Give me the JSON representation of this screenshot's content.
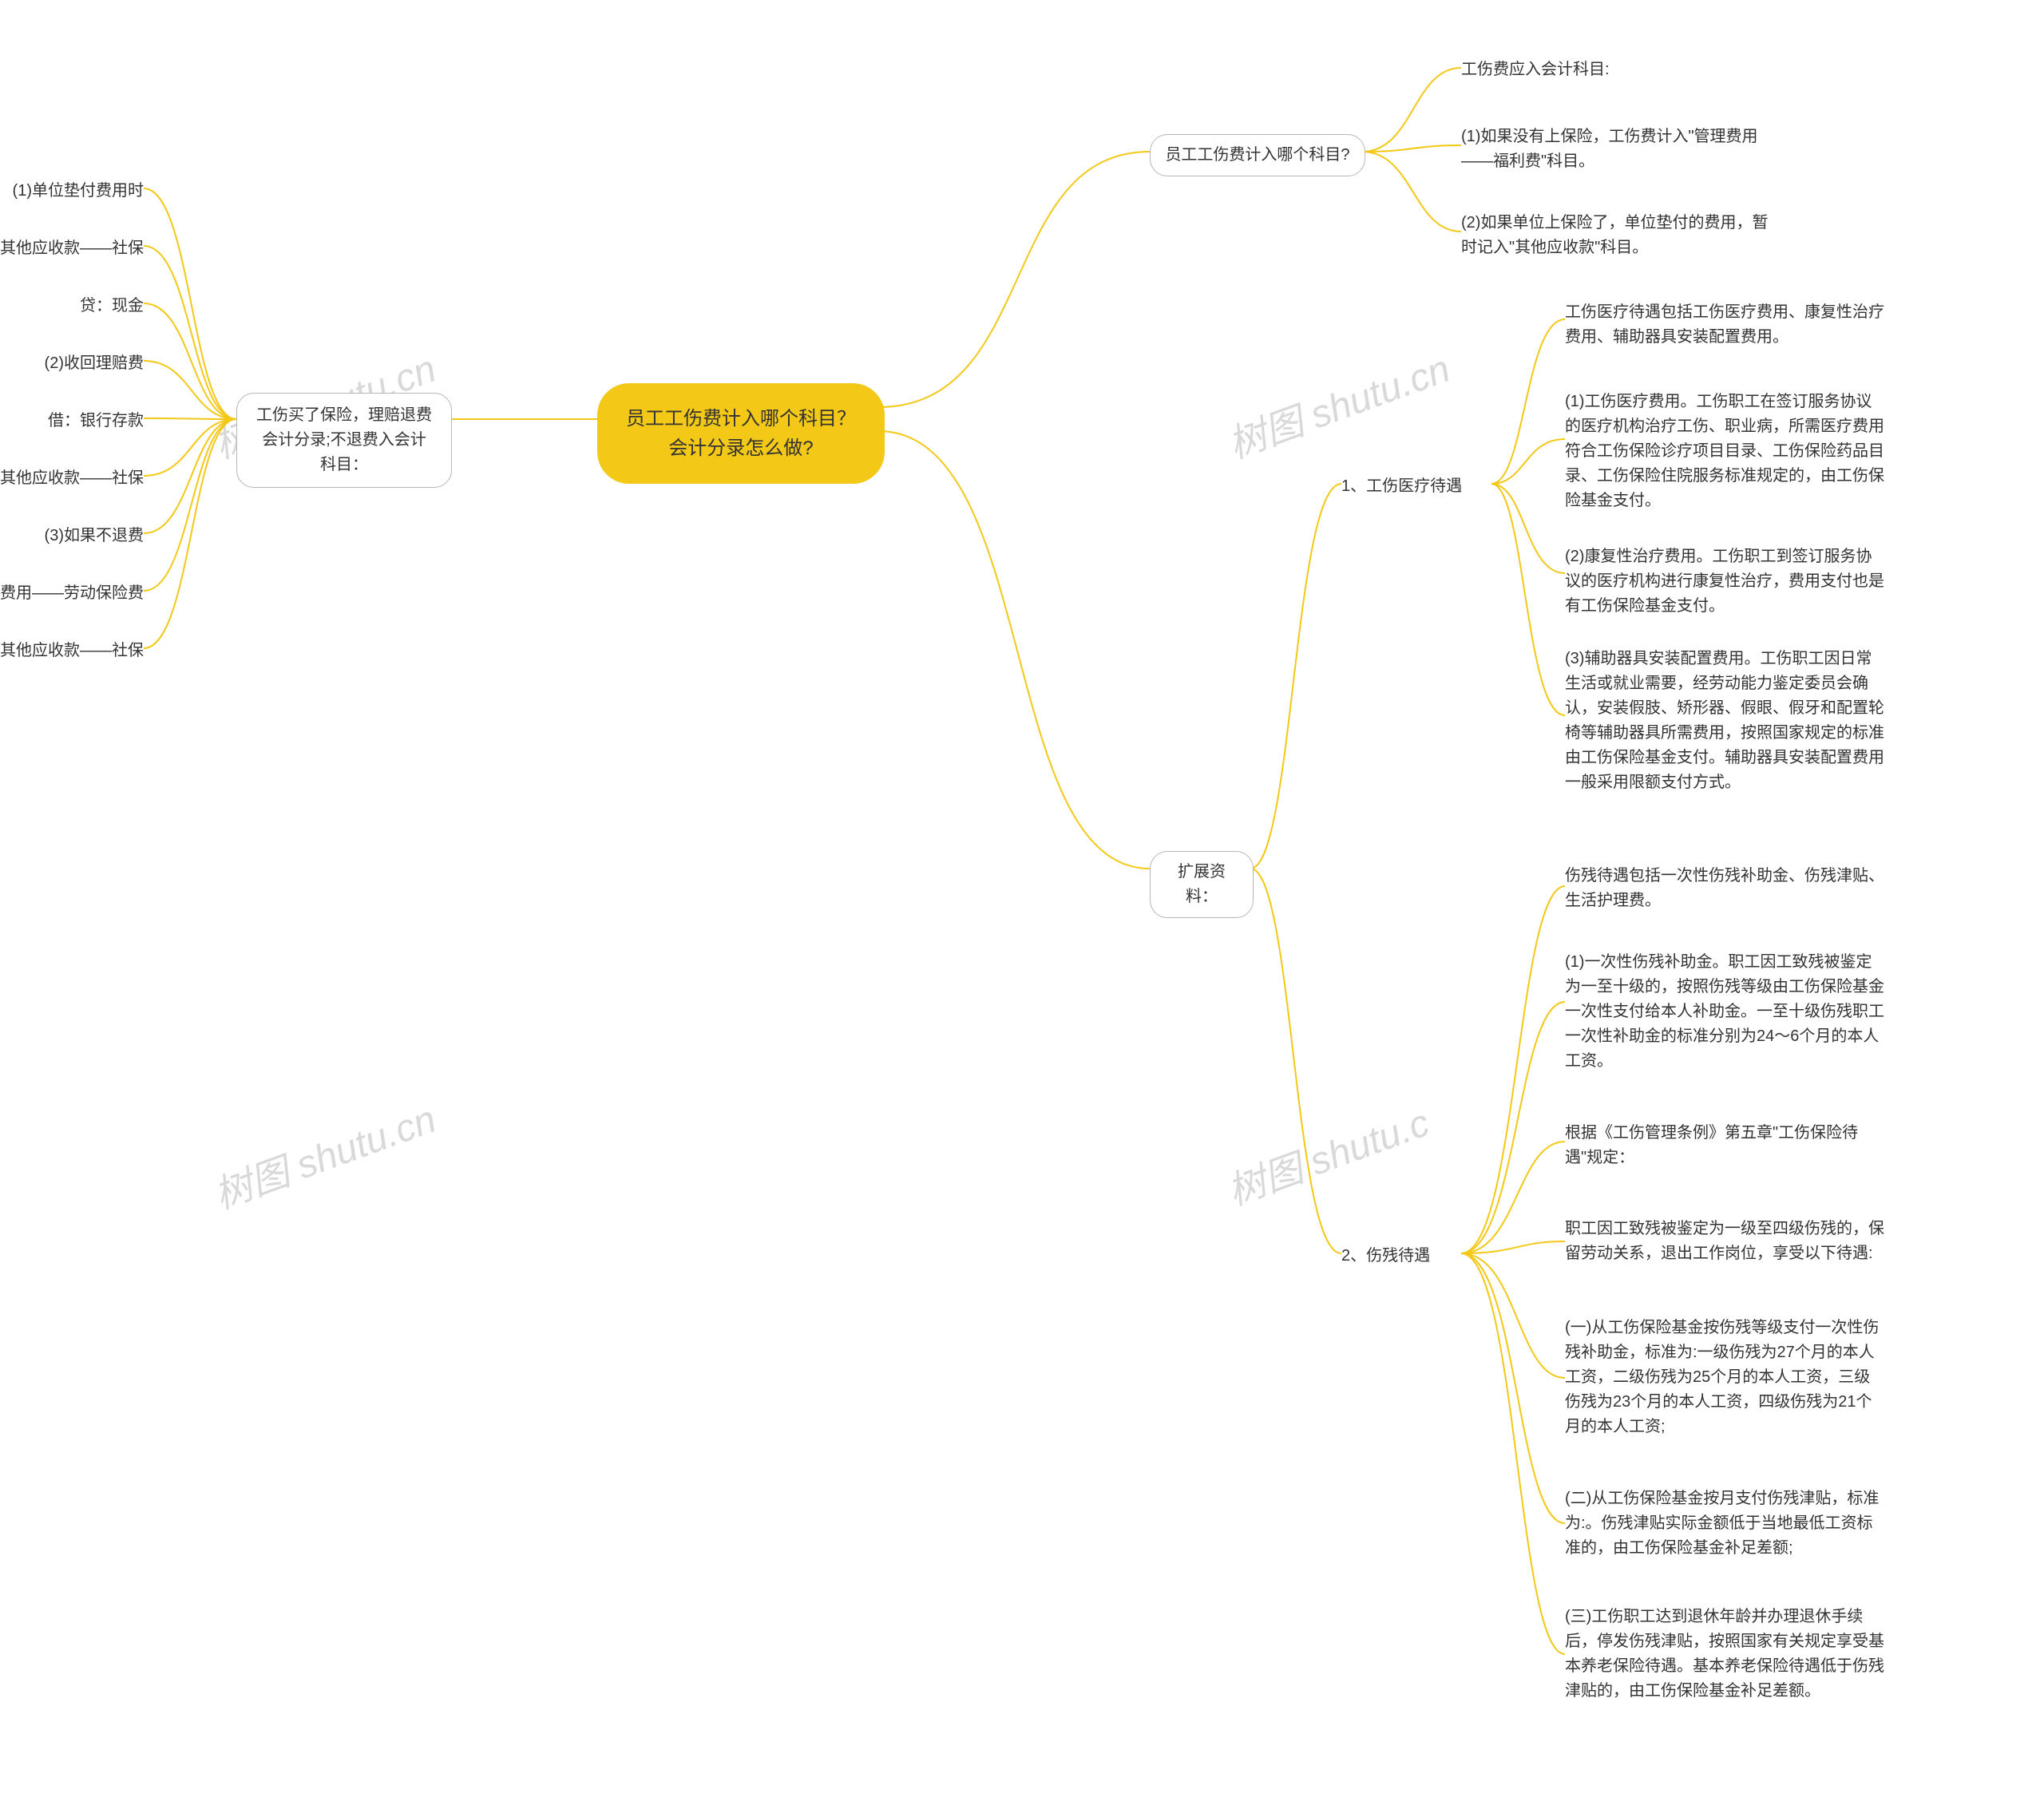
{
  "root": "员工工伤费计入哪个科目？会计分录怎么做?",
  "watermarks": [
    "树图 shutu.cn",
    "树图 shutu.cn",
    "树图 shutu.cn",
    "树图 shutu.c"
  ],
  "left": {
    "branch": "工伤买了保险，理赔退费会计分录;不退费入会计科目：",
    "leaves": [
      "(1)单位垫付费用时",
      "借：其他应收款——社保",
      "贷：现金",
      "(2)收回理赔费",
      "借：银行存款",
      "贷：其他应收款——社保",
      "(3)如果不退费",
      "借：管理费用——劳动保险费",
      "贷：其他应收款——社保"
    ]
  },
  "right": {
    "branch1": {
      "label": "员工工伤费计入哪个科目?",
      "leaves": [
        "工伤费应入会计科目:",
        "(1)如果没有上保险，工伤费计入\"管理费用——福利费\"科目。",
        "(2)如果单位上保险了，单位垫付的费用，暂时记入\"其他应收款\"科目。"
      ]
    },
    "branch2": {
      "label": "扩展资料：",
      "sub1": {
        "label": "1、工伤医疗待遇",
        "leaves": [
          "工伤医疗待遇包括工伤医疗费用、康复性治疗费用、辅助器具安装配置费用。",
          "(1)工伤医疗费用。工伤职工在签订服务协议的医疗机构治疗工伤、职业病，所需医疗费用符合工伤保险诊疗项目目录、工伤保险药品目录、工伤保险住院服务标准规定的，由工伤保险基金支付。",
          "(2)康复性治疗费用。工伤职工到签订服务协议的医疗机构进行康复性治疗，费用支付也是有工伤保险基金支付。",
          "(3)辅助器具安装配置费用。工伤职工因日常生活或就业需要，经劳动能力鉴定委员会确认，安装假肢、矫形器、假眼、假牙和配置轮椅等辅助器具所需费用，按照国家规定的标准由工伤保险基金支付。辅助器具安装配置费用一般采用限额支付方式。"
        ]
      },
      "sub2": {
        "label": "2、伤残待遇",
        "leaves": [
          "伤残待遇包括一次性伤残补助金、伤残津贴、生活护理费。",
          "(1)一次性伤残补助金。职工因工致残被鉴定为一至十级的，按照伤残等级由工伤保险基金一次性支付给本人补助金。一至十级伤残职工一次性补助金的标准分别为24～6个月的本人工资。",
          "根据《工伤管理条例》第五章\"工伤保险待遇\"规定：",
          "职工因工致残被鉴定为一级至四级伤残的，保留劳动关系，退出工作岗位，享受以下待遇:",
          "(一)从工伤保险基金按伤残等级支付一次性伤残补助金，标准为:一级伤残为27个月的本人工资，二级伤残为25个月的本人工资，三级伤残为23个月的本人工资，四级伤残为21个月的本人工资;",
          "(二)从工伤保险基金按月支付伤残津贴，标准为:。伤残津贴实际金额低于当地最低工资标准的，由工伤保险基金补足差额;",
          "(三)工伤职工达到退休年龄并办理退休手续后，停发伤残津贴，按照国家有关规定享受基本养老保险待遇。基本养老保险待遇低于伤残津贴的，由工伤保险基金补足差额。"
        ]
      }
    }
  }
}
